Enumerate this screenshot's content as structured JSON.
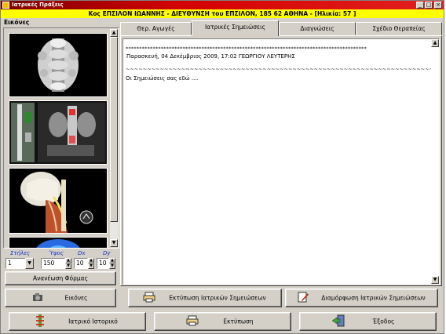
{
  "window": {
    "title": "Ιατρικές Πράξεις",
    "controls": {
      "minimize": "_",
      "maximize": "□",
      "close": "×"
    }
  },
  "patient_banner": "Κος ΕΠΣΙΛΟΝ ΙΩΑΝΝΗΣ - ΔΙΕΥΘΥΝΣΗ του ΕΠΣΙΛΟΝ, 185 62 ΑΘΗΝΑ - [Ηλικία: 57 ]",
  "images_panel": {
    "label": "Εικόνες",
    "thumbnails": [
      "ct-cervical-spine",
      "ct-coronal-kidneys",
      "ct-3d-head-neck",
      "ct-blue-scan"
    ],
    "controls": {
      "columns_label": "Στήλες",
      "columns_value": "1",
      "height_label": "Ύψος",
      "height_value": "150",
      "dx_label": "Dx",
      "dx_value": "10",
      "dy_label": "Dy",
      "dy_value": "10"
    },
    "refresh_button": "Ανανέωση Φόρμας",
    "images_button": "Εικόνες"
  },
  "tabs": [
    {
      "label": "Θερ. Αγωγές",
      "active": false
    },
    {
      "label": "Ιατρικές Σημειώσεις",
      "active": true
    },
    {
      "label": "Διαγνώσεις",
      "active": false
    },
    {
      "label": "Σχέδιο Θεραπείας",
      "active": false
    }
  ],
  "notes": {
    "stars": "*****************************************************************************************",
    "stamp": "Παρασκευή, 04 Δεκέμβριος 2009, 17:02 ΓΕΩΡΓΙΟΥ ΛΕΥΤΕΡΗΣ",
    "tildes": "~~~~~~~~~~~~~~~~~~~~~~~~~~~~~~~~~~~~~~~~~~~~~~~~~~~~~~~~~~~~~~~~~~~~~~~~~~~~~~~~~~~~~~~~~~~~~~~~~~~~~~~~~~~~~~~~~~~",
    "text": "Οι Σημειώσεις σας εδώ ...."
  },
  "tab_buttons": {
    "print_notes": "Εκτύπωση Ιατρικών Σημειώσεων",
    "format_notes": "Διαμόρφωση Ιατρικών Σημειώσεων"
  },
  "bottom_buttons": {
    "history": "Ιατρικό Ιστορικό",
    "print": "Εκτύπωση",
    "exit": "Έξοδος"
  },
  "colors": {
    "banner": "#ffff00",
    "title_bar": "#d30000",
    "label_blue": "#1030c0"
  }
}
